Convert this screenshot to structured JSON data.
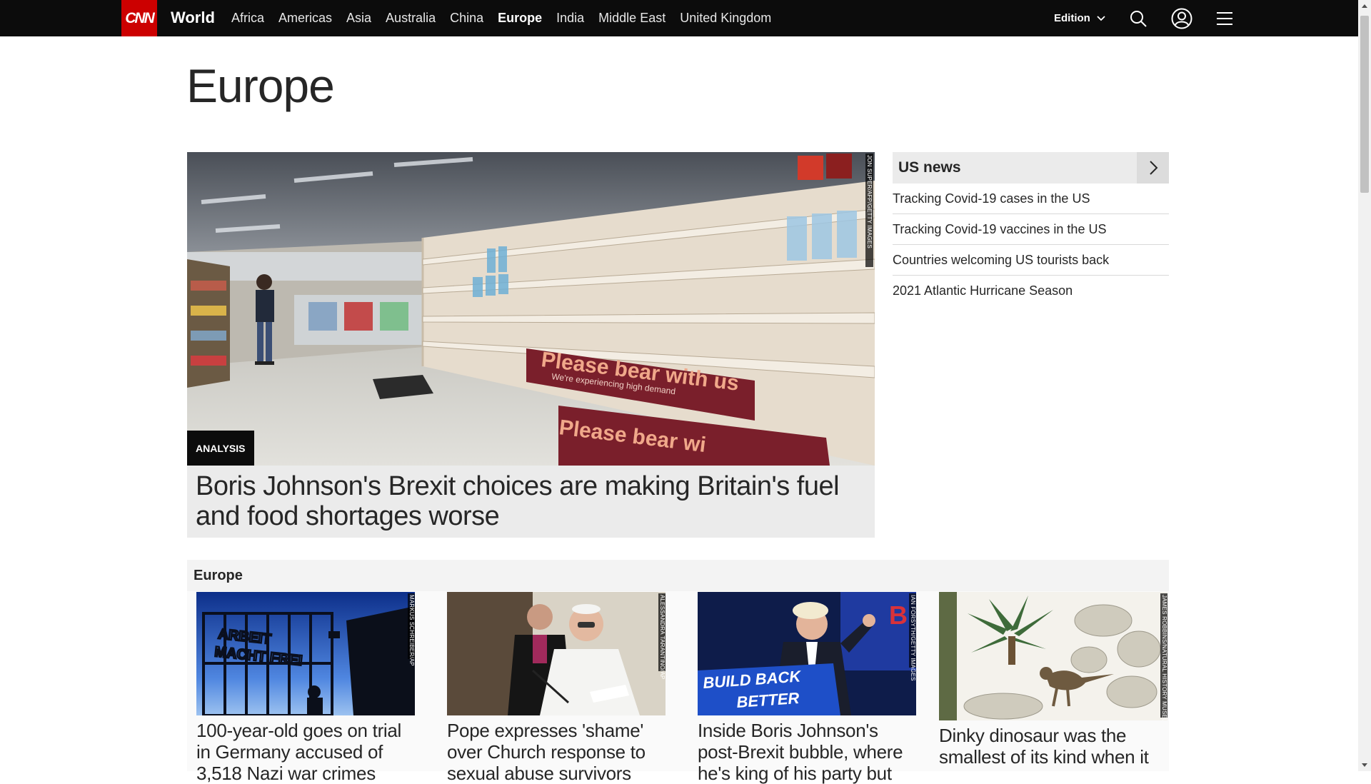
{
  "nav": {
    "logo": "CNN",
    "section": "World",
    "links": [
      "Africa",
      "Americas",
      "Asia",
      "Australia",
      "China",
      "Europe",
      "India",
      "Middle East",
      "United Kingdom"
    ],
    "active_link": "Europe",
    "edition_label": "Edition",
    "icons": [
      "search-icon",
      "account-icon",
      "menu-icon"
    ]
  },
  "page": {
    "title": "Europe"
  },
  "hero": {
    "badge": "ANALYSIS",
    "headline": "Boris Johnson's Brexit choices are making Britain's fuel and food shortages worse",
    "photo_credit": "JON SUPER/AFP/GETTY IMAGES",
    "sign_text_1": "Please bear with us",
    "sign_text_2": "We're experiencing high demand",
    "sign_text_3": "Please bear wi"
  },
  "side": {
    "title": "US news",
    "items": [
      "Tracking Covid-19 cases in the US",
      "Tracking Covid-19 vaccines in the US",
      "Countries welcoming US tourists back",
      "2021 Atlantic Hurricane Season"
    ]
  },
  "zone": {
    "title": "Europe",
    "cards": [
      {
        "headline": "100-year-old goes on trial in Germany accused of 3,518 Nazi war crimes",
        "credit": "MARKUS SCHREIBER/AP"
      },
      {
        "headline": "Pope expresses 'shame' over Church response to sexual abuse survivors",
        "credit": "ALESSANDRA TARANTINO/AP"
      },
      {
        "headline": "Inside Boris Johnson's post-Brexit bubble, where he's king of his party but",
        "credit": "IAN FORSYTH/GETTY IMAGES",
        "sign": "BUILD BACK BETTER"
      },
      {
        "headline": "Dinky dinosaur was the smallest of its kind when it",
        "credit": "JAMES ROBBINS/NATURAL HISTORY MUSEUM"
      }
    ]
  },
  "colors": {
    "nav_bg": "#0c0c0c",
    "brand_red": "#cc0000",
    "text": "#262626",
    "panel_bg": "#ebebeb"
  }
}
